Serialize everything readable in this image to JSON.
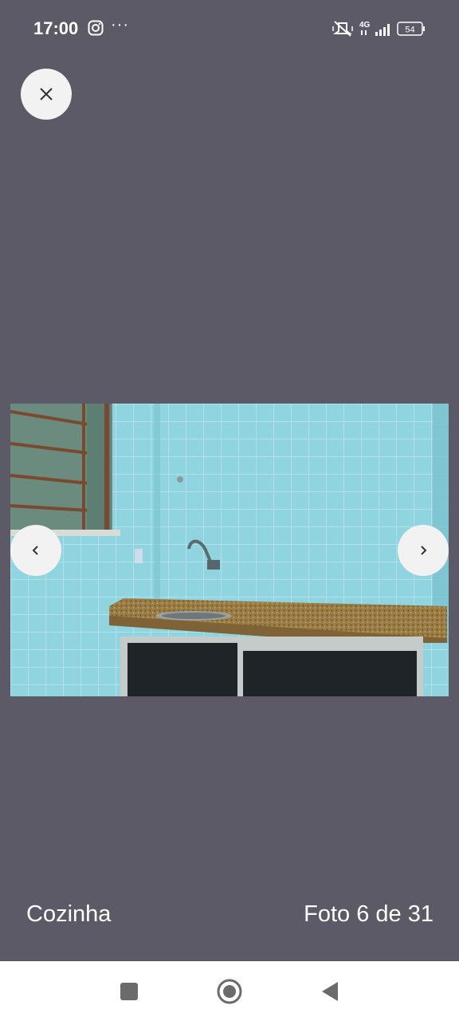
{
  "status_bar": {
    "time": "17:00",
    "more": "···",
    "network": "4G",
    "battery": "54",
    "icons": [
      "instagram-icon",
      "more-icon",
      "muted-icon",
      "signal-icon",
      "battery-icon"
    ]
  },
  "photo": {
    "caption": "Cozinha",
    "counter": "Foto 6 de 31"
  },
  "colors": {
    "background": "#5b5a66",
    "button_bg": "#f2f2f2",
    "nav_bar": "#ffffff",
    "nav_icons": "#6b6b6b"
  }
}
